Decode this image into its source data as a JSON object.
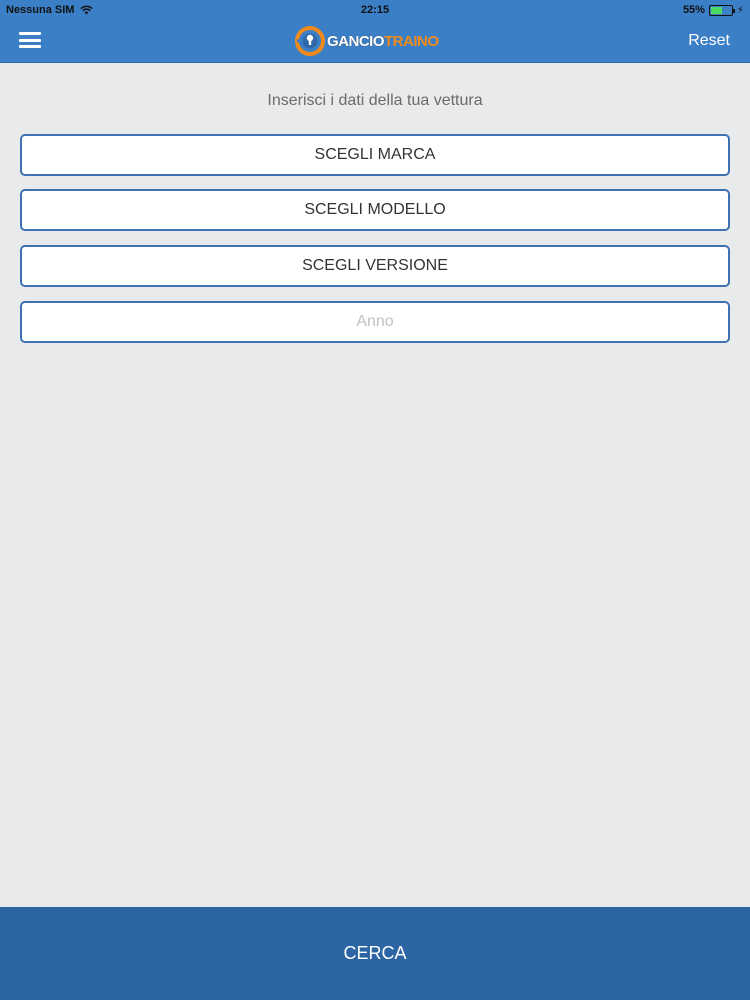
{
  "status": {
    "carrier": "Nessuna SIM",
    "time": "22:15",
    "battery": "55%",
    "battery_level": 0.55
  },
  "header": {
    "menu_icon": "hamburger-menu-icon",
    "logo_text_part1": "GANCIO",
    "logo_text_part2": "TRAINO",
    "reset_label": "Reset",
    "colors": {
      "bar": "#3b7fc6",
      "logo_orange": "#f18a1c"
    }
  },
  "form": {
    "prompt": "Inserisci i dati della tua vettura",
    "brand_label": "SCEGLI MARCA",
    "model_label": "SCEGLI MODELLO",
    "version_label": "SCEGLI VERSIONE",
    "year_placeholder": "Anno",
    "year_value": ""
  },
  "footer": {
    "search_label": "CERCA",
    "color": "#2c65a3"
  }
}
